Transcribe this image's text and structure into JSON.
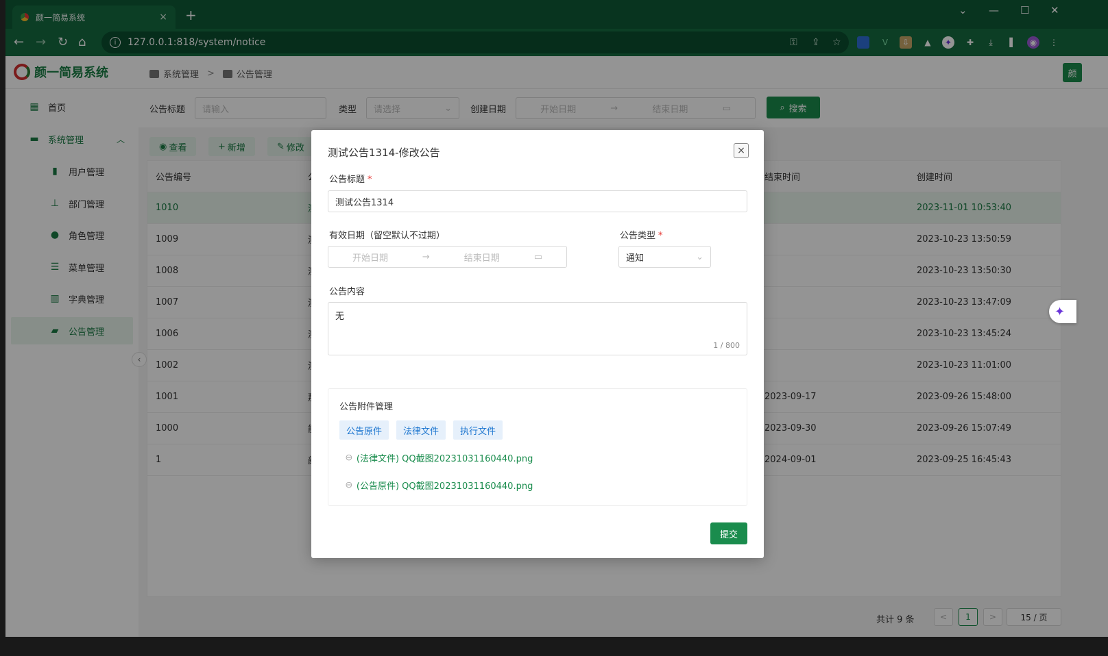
{
  "browser": {
    "tab_title": "颜一简易系统",
    "tab_close": "×",
    "new_tab": "+",
    "url": "127.0.0.1:818/system/notice"
  },
  "app": {
    "logo_text": "颜一简易系统",
    "breadcrumb": [
      "系统管理",
      ">",
      "公告管理"
    ],
    "avatar": "颜"
  },
  "sidebar": {
    "items": [
      {
        "label": "首页",
        "icon": "grid-icon"
      },
      {
        "label": "系统管理",
        "icon": "folder-icon"
      },
      {
        "label": "用户管理",
        "icon": "user-badge-icon"
      },
      {
        "label": "部门管理",
        "icon": "org-icon"
      },
      {
        "label": "角色管理",
        "icon": "user-icon"
      },
      {
        "label": "菜单管理",
        "icon": "list-icon"
      },
      {
        "label": "字典管理",
        "icon": "book-icon"
      },
      {
        "label": "公告管理",
        "icon": "message-icon"
      }
    ]
  },
  "search": {
    "title_label": "公告标题",
    "title_placeholder": "请输入",
    "type_label": "类型",
    "type_placeholder": "请选择",
    "date_label": "创建日期",
    "start_placeholder": "开始日期",
    "arrow": "→",
    "end_placeholder": "结束日期",
    "search_button": "搜索"
  },
  "actions": {
    "view": "查看",
    "add": "新增",
    "edit": "修改"
  },
  "table": {
    "headers": {
      "id": "公告编号",
      "title": "公",
      "end": "结束时间",
      "created": "创建时间"
    },
    "rows": [
      {
        "id": "1010",
        "title": "测",
        "end": "",
        "created": "2023-11-01 10:53:40"
      },
      {
        "id": "1009",
        "title": "测",
        "end": "",
        "created": "2023-10-23 13:50:59"
      },
      {
        "id": "1008",
        "title": "测",
        "end": "",
        "created": "2023-10-23 13:50:30"
      },
      {
        "id": "1007",
        "title": "测",
        "end": "",
        "created": "2023-10-23 13:47:09"
      },
      {
        "id": "1006",
        "title": "测",
        "end": "",
        "created": "2023-10-23 13:45:24"
      },
      {
        "id": "1002",
        "title": "测",
        "end": "",
        "created": "2023-10-23 11:01:00"
      },
      {
        "id": "1001",
        "title": "那",
        "end": "2023-09-17",
        "created": "2023-09-26 15:48:00"
      },
      {
        "id": "1000",
        "title": "能",
        "end": "2023-09-30",
        "created": "2023-09-26 15:07:49"
      },
      {
        "id": "1",
        "title": "颜",
        "end": "2024-09-01",
        "created": "2023-09-25 16:45:43"
      }
    ]
  },
  "pagination": {
    "total": "共计 9 条",
    "prev": "<",
    "current": "1",
    "next": ">",
    "page_size": "15 / 页"
  },
  "modal": {
    "title": "测试公告1314-修改公告",
    "close": "×",
    "title_label": "公告标题",
    "required": "*",
    "title_value": "测试公告1314",
    "date_label": "有效日期（留空默认不过期）",
    "start_placeholder": "开始日期",
    "arrow": "→",
    "end_placeholder": "结束日期",
    "type_label": "公告类型",
    "type_value": "通知",
    "content_label": "公告内容",
    "content_value": "无",
    "char_count": "1 / 800",
    "attachments_title": "公告附件管理",
    "tags": [
      "公告原件",
      "法律文件",
      "执行文件"
    ],
    "files": [
      "(法律文件) QQ截图20231031160440.png",
      "(公告原件) QQ截图20231031160440.png"
    ],
    "submit": "提交"
  }
}
